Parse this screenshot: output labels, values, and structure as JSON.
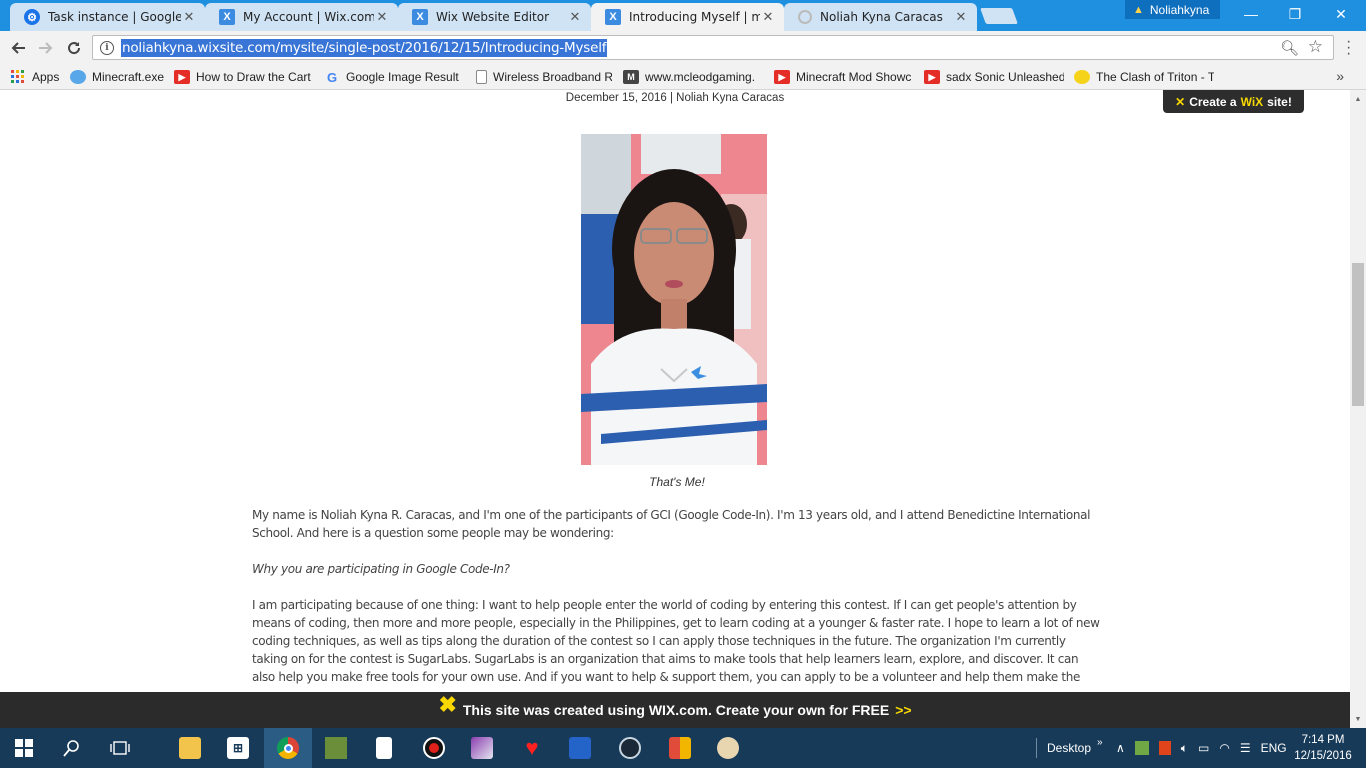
{
  "browser": {
    "tabs": [
      {
        "title": "Task instance | Google Co",
        "icon": "gear-icon",
        "active": false
      },
      {
        "title": "My Account | Wix.com",
        "icon": "wix-icon",
        "active": false
      },
      {
        "title": "Wix Website Editor",
        "icon": "wix-icon",
        "active": false
      },
      {
        "title": "Introducing Myself | mys",
        "icon": "wix-icon",
        "active": true
      },
      {
        "title": "Noliah Kyna Caracas",
        "icon": "loading-icon",
        "active": false
      }
    ],
    "profile_name": "Noliahkyna",
    "url": "noliahkyna.wixsite.com/mysite/single-post/2016/12/15/Introducing-Myself",
    "bookmarks": [
      {
        "label": "Apps",
        "icon": "apps-grid-icon"
      },
      {
        "label": "Minecraft.exe",
        "icon": "bird-icon"
      },
      {
        "label": "How to Draw the Cart",
        "icon": "youtube-icon"
      },
      {
        "label": "Google Image Result f",
        "icon": "google-icon"
      },
      {
        "label": "Wireless Broadband R",
        "icon": "page-icon"
      },
      {
        "label": "www.mcleodgaming.",
        "icon": "mcleod-icon"
      },
      {
        "label": "Minecraft Mod Showc",
        "icon": "youtube-icon"
      },
      {
        "label": "sadx Sonic Unleashed",
        "icon": "youtube-icon"
      },
      {
        "label": "The Clash of Triton - T",
        "icon": "spongebob-icon"
      }
    ],
    "more_bookmarks": "»"
  },
  "post": {
    "meta": "December 15, 2016   |  Noliah Kyna Caracas",
    "create_site_badge": {
      "prefix": "Create a",
      "brand": "WiX",
      "suffix": "site!"
    },
    "caption": "That's Me!",
    "paragraphs": [
      "My name is Noliah Kyna R. Caracas, and I'm one of the participants of GCI (Google Code-In). I'm 13 years old, and I attend Benedictine International School. And here is a question some people may be wondering:",
      "Why you are participating in Google Code-In?",
      "I am participating because of one thing: I want to help people enter the world of coding by entering this contest. If I can get people's attention by means of coding, then more and more people, especially in the Philippines, get to learn coding at a younger & faster rate. I hope to learn a lot of new coding techniques, as well as tips along the duration of the contest so I can apply those techniques in the future. The organization I'm currently taking on for the contest is SugarLabs. SugarLabs is an organization that aims to make tools that help learners learn, explore, and discover. It can also help you make free tools for your own use. And if you want to help & support them, you can apply to be a volunteer and help them make the"
    ]
  },
  "wix_banner": {
    "text": "This site was created using WIX.com. Create your own for FREE",
    "arrows": ">>"
  },
  "taskbar": {
    "desktop_label": "Desktop",
    "language": "ENG",
    "time": "7:14 PM",
    "date": "12/15/2016"
  }
}
